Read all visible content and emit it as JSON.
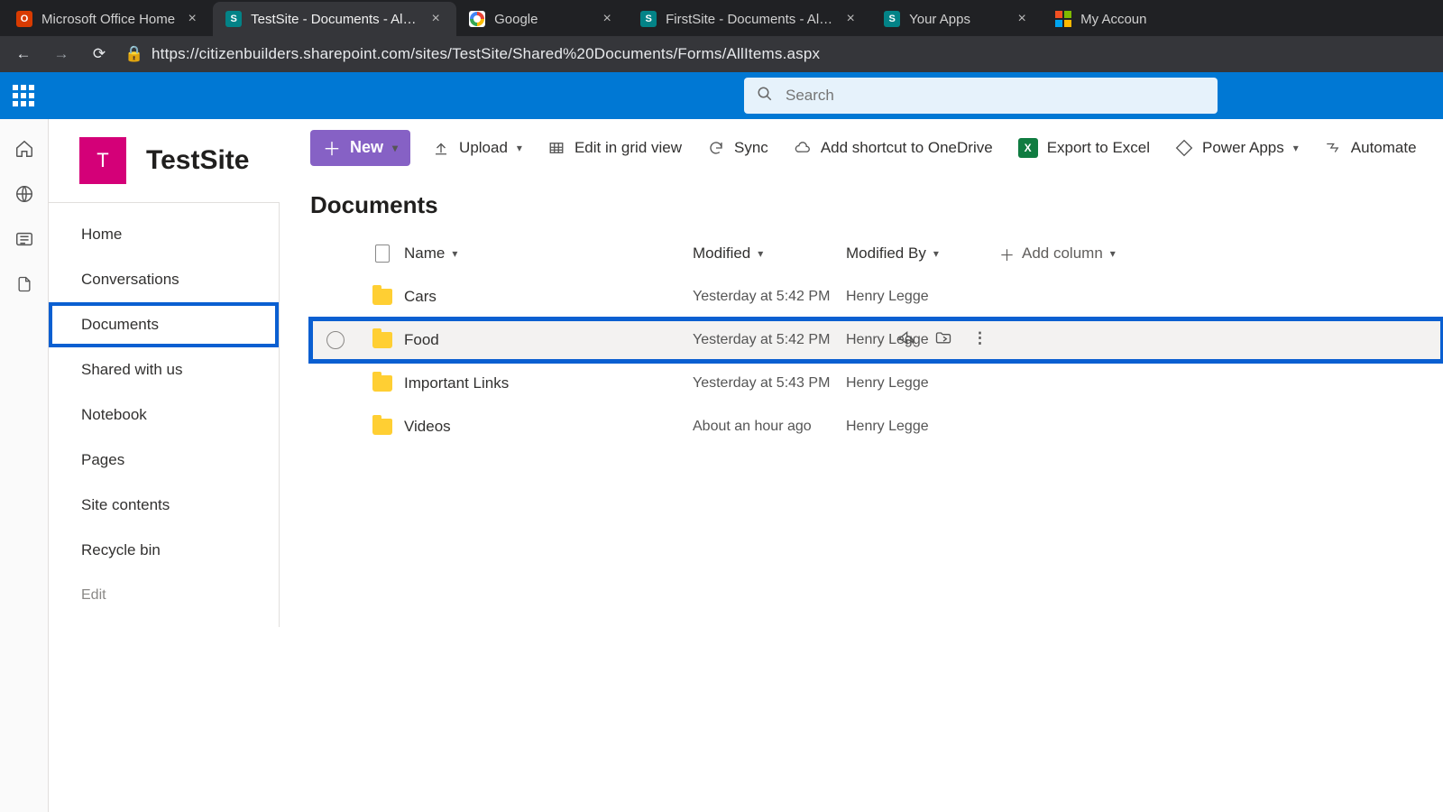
{
  "browser": {
    "tabs": [
      {
        "title": "Microsoft Office Home",
        "favicon": "office"
      },
      {
        "title": "TestSite - Documents - All Docu",
        "favicon": "sharepoint",
        "active": true
      },
      {
        "title": "Google",
        "favicon": "google"
      },
      {
        "title": "FirstSite - Documents - All Docu",
        "favicon": "sharepoint"
      },
      {
        "title": "Your Apps",
        "favicon": "sharepoint"
      },
      {
        "title": "My Accoun",
        "favicon": "ms4"
      }
    ],
    "url": "https://citizenbuilders.sharepoint.com/sites/TestSite/Shared%20Documents/Forms/AllItems.aspx"
  },
  "suite": {
    "search_placeholder": "Search"
  },
  "site": {
    "logo_letter": "T",
    "title": "TestSite"
  },
  "nav": {
    "items": [
      "Home",
      "Conversations",
      "Documents",
      "Shared with us",
      "Notebook",
      "Pages",
      "Site contents",
      "Recycle bin"
    ],
    "edit_label": "Edit",
    "selected_index": 2
  },
  "commands": {
    "new": "New",
    "upload": "Upload",
    "edit_grid": "Edit in grid view",
    "sync": "Sync",
    "add_shortcut": "Add shortcut to OneDrive",
    "export_excel": "Export to Excel",
    "power_apps": "Power Apps",
    "automate": "Automate"
  },
  "list": {
    "title": "Documents",
    "columns": {
      "name": "Name",
      "modified": "Modified",
      "modified_by": "Modified By",
      "add": "Add column"
    },
    "rows": [
      {
        "name": "Cars",
        "modified": "Yesterday at 5:42 PM",
        "by": "Henry Legge"
      },
      {
        "name": "Food",
        "modified": "Yesterday at 5:42 PM",
        "by": "Henry Legge",
        "hover": true,
        "highlight": true
      },
      {
        "name": "Important Links",
        "modified": "Yesterday at 5:43 PM",
        "by": "Henry Legge"
      },
      {
        "name": "Videos",
        "modified": "About an hour ago",
        "by": "Henry Legge"
      }
    ]
  }
}
